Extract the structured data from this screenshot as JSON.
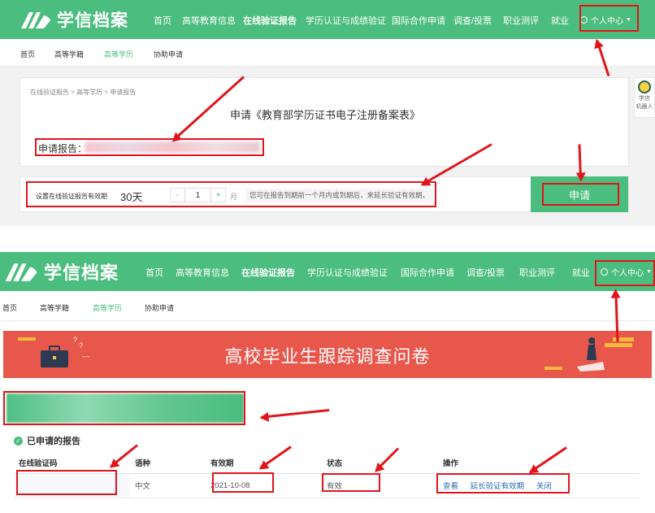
{
  "top": {
    "brand": "学信档案",
    "nav": [
      "首页",
      "高等教育信息",
      "在线验证报告",
      "学历认证与成绩验证",
      "国际合作申请",
      "调查/投票",
      "职业测评",
      "就业"
    ],
    "user_menu": "个人中心",
    "subnav": [
      "首页",
      "高等学籍",
      "高等学历",
      "协助申请"
    ],
    "breadcrumb": [
      "在线验证报告",
      "高等学历",
      "申请报告"
    ],
    "breadcrumb_sep": ">",
    "heading": "申请《教育部学历证书电子注册备案表》",
    "report_label": "申请报告：",
    "validity_label": "设置在线验证报告有效期",
    "validity_value": "30天",
    "stepper_minus": "-",
    "stepper_value": "1",
    "stepper_plus": "+",
    "stepper_unit": "月",
    "validity_hint": "您可在报告到期前一个月内或到期后，来延长验证有效期。",
    "apply_button": "申请",
    "robot_text": [
      "学信",
      "机器人"
    ]
  },
  "bottom": {
    "brand": "学信档案",
    "nav": [
      "首页",
      "高等教育信息",
      "在线验证报告",
      "学历认证与成绩验证",
      "国际合作申请",
      "调查/投票",
      "职业测评",
      "就业"
    ],
    "user_menu": "个人中心",
    "subnav": [
      "首页",
      "高等学籍",
      "高等学历",
      "协助申请"
    ],
    "banner_title": "高校毕业生跟踪调查问卷",
    "banner_marks": [
      "?",
      "?",
      "—"
    ],
    "section_title": "已申请的报告",
    "table": {
      "headers": [
        "在线验证码",
        "语种",
        "有效期",
        "状态",
        "操作"
      ],
      "rows": [
        {
          "code": "",
          "language": "中文",
          "expiry": "2021-10-08",
          "status": "有效",
          "actions": [
            "查看",
            "延长验证有效期",
            "关闭"
          ]
        }
      ]
    }
  },
  "colors": {
    "brand_green": "#4bbd7e",
    "annotation_red": "#e0151c",
    "banner_red": "#e8574c",
    "link_blue": "#2b6fb6"
  }
}
